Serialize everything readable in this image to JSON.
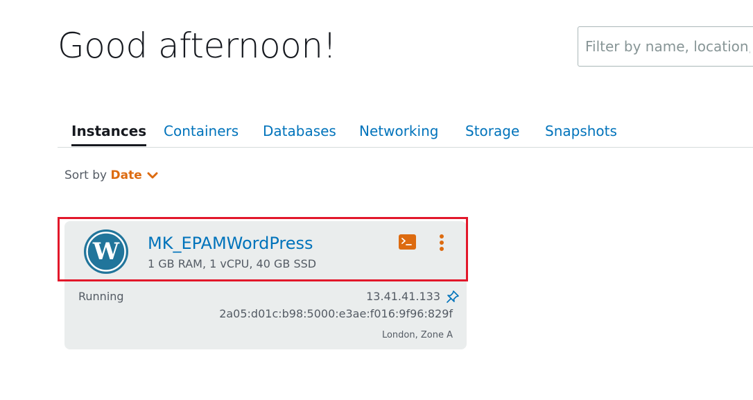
{
  "header": {
    "greeting": "Good afternoon!",
    "filter_placeholder": "Filter by name, location, tag, or type"
  },
  "tabs": [
    {
      "label": "Instances",
      "active": true
    },
    {
      "label": "Containers",
      "active": false
    },
    {
      "label": "Databases",
      "active": false
    },
    {
      "label": "Networking",
      "active": false
    },
    {
      "label": "Storage",
      "active": false
    },
    {
      "label": "Snapshots",
      "active": false
    }
  ],
  "sort": {
    "label": "Sort by",
    "value": "Date",
    "icon": "chevron-down-icon"
  },
  "instance": {
    "name": "MK_EPAMWordPress",
    "spec": "1 GB RAM, 1 vCPU, 40 GB SSD",
    "status": "Running",
    "public_ip": "13.41.41.133",
    "ipv6": "2a05:d01c:b98:5000:e3ae:f016:9f96:829f",
    "location": "London, Zone A",
    "logo_icon": "wordpress-logo-icon",
    "actions": [
      "terminal-icon",
      "kebab-menu-icon",
      "pin-icon"
    ]
  },
  "colors": {
    "link": "#0073bb",
    "accent": "#dd6b10",
    "text": "#16191f",
    "secondary_text": "#545b64",
    "card_bg": "#eaeded",
    "highlight": "#e2172a"
  }
}
